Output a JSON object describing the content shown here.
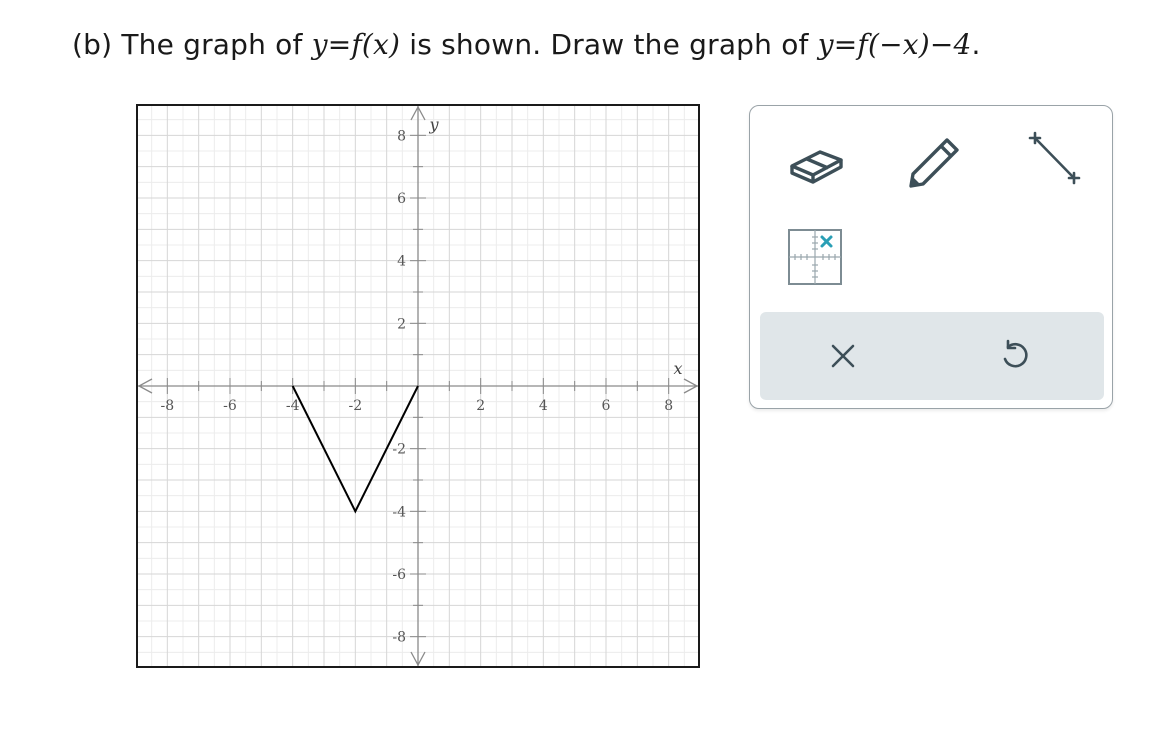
{
  "prompt": {
    "label": "(b)",
    "text1": "The graph of",
    "given_func": "y=f(x)",
    "text2": "is shown. Draw the graph of",
    "target_func": "y=f(−x)−4",
    "end": "."
  },
  "graph": {
    "x_axis_label": "x",
    "y_axis_label": "y",
    "x_tick_labels": [
      "-8",
      "-6",
      "-4",
      "-2",
      "2",
      "4",
      "6",
      "8"
    ],
    "y_tick_labels": [
      "8",
      "6",
      "4",
      "2",
      "-2",
      "-4",
      "-6",
      "-8"
    ]
  },
  "chart_data": {
    "type": "line",
    "x": [
      -4,
      -2,
      0
    ],
    "y": [
      0,
      -4,
      0
    ],
    "xlim": [
      -9,
      9
    ],
    "ylim": [
      -9,
      9
    ],
    "x_ticks": [
      -8,
      -6,
      -4,
      -2,
      2,
      4,
      6,
      8
    ],
    "y_ticks": [
      -8,
      -6,
      -4,
      -2,
      2,
      4,
      6,
      8
    ],
    "grid": true,
    "minor_grid": true,
    "line_color": "#000000"
  },
  "toolbox": {
    "tools": [
      {
        "name": "eraser-tool",
        "icon": "eraser-icon"
      },
      {
        "name": "pencil-tool",
        "icon": "pencil-icon"
      },
      {
        "name": "line-segment-tool",
        "icon": "line-segment-icon"
      },
      {
        "name": "point-tool",
        "icon": "grid-point-icon"
      }
    ],
    "actions": [
      {
        "name": "clear-button",
        "icon": "close-icon"
      },
      {
        "name": "undo-button",
        "icon": "undo-icon"
      }
    ],
    "icon_color": "#3d4f58",
    "accent_color": "#2a9fb5"
  }
}
